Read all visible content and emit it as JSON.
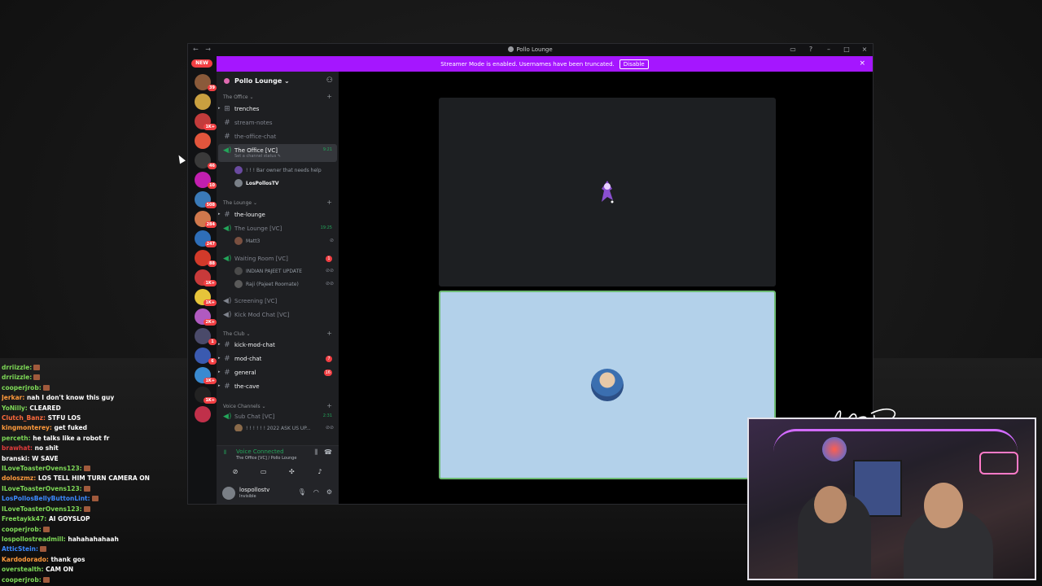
{
  "window": {
    "title": "Pollo Lounge",
    "nav_back": "←",
    "nav_forward": "→"
  },
  "streamer_bar": {
    "message": "Streamer Mode is enabled. Usernames have been truncated.",
    "button": "Disable"
  },
  "rail": {
    "new_badge": "NEW",
    "servers": [
      {
        "badge": "39",
        "color": "#8a5a3a"
      },
      {
        "badge": "",
        "color": "#c9a040"
      },
      {
        "badge": "1K+",
        "color": "#c23b3b"
      },
      {
        "badge": "",
        "color": "#e2553c"
      },
      {
        "badge": "46",
        "color": "#3a3a3a"
      },
      {
        "badge": "10",
        "color": "#c21fb0"
      },
      {
        "badge": "508",
        "color": "#3a7ab8"
      },
      {
        "badge": "284",
        "color": "#d0784c"
      },
      {
        "badge": "247",
        "color": "#2e6eb8"
      },
      {
        "badge": "88",
        "color": "#d23a2a"
      },
      {
        "badge": "1K+",
        "color": "#c83a3a"
      },
      {
        "badge": "1K+",
        "color": "#e6c43a"
      },
      {
        "badge": "2K+",
        "color": "#b05ac0"
      },
      {
        "badge": "1",
        "color": "#4a4a6a"
      },
      {
        "badge": "6",
        "color": "#3a5ab0"
      },
      {
        "badge": "1K+",
        "color": "#3a8ad0"
      },
      {
        "badge": "1K+",
        "color": "#222222"
      },
      {
        "badge": "",
        "color": "#c0304a"
      }
    ]
  },
  "guild": {
    "name": "Pollo Lounge ⌄"
  },
  "categories": {
    "office": "The Office ⌄",
    "lounge": "The Lounge ⌄",
    "club": "The Club ⌄",
    "voice": "Voice Channels ⌄"
  },
  "channels": {
    "trenches": "trenches",
    "stream_notes": "stream-notes",
    "office_chat": "the-office-chat",
    "office_vc": "The Office [VC]",
    "office_vc_time": "9:21",
    "office_vc_status": "Set a channel status ✎",
    "office_user1": "! ! ! Bar owner that needs help",
    "office_user2": "LosPollosTV",
    "the_lounge": "the-lounge",
    "lounge_vc": "The Lounge [VC]",
    "lounge_vc_time": "19:25",
    "lounge_user": "Matt3",
    "waiting_vc": "Waiting Room [VC]",
    "waiting_count": "1",
    "waiting_user1": "INDIAN PAJEET UPDATE",
    "waiting_user2": "Raji (Pajeet Roomate)",
    "screening_vc": "Screening [VC]",
    "kick_mod_vc": "Kick Mod Chat [VC]",
    "kick_mod_chat": "kick-mod-chat",
    "mod_chat": "mod-chat",
    "mod_chat_count": "7",
    "general": "general",
    "general_count": "16",
    "the_cave": "the-cave",
    "sub_chat_vc": "Sub Chat [VC]",
    "sub_chat_time": "2:31",
    "sub_chat_user": "! ! ! ! ! ! 2022 ASK US UP..."
  },
  "voice_panel": {
    "title": "Voice Connected",
    "subtitle": "The Office [VC] / Pollo Lounge"
  },
  "user_panel": {
    "username": "lospollostv",
    "status": "Invisible"
  },
  "chat": [
    {
      "user": "drriizzle:",
      "color": "#7ed957",
      "text": ""
    },
    {
      "user": "drriizzle:",
      "color": "#7ed957",
      "text": ""
    },
    {
      "user": "cooperjrob:",
      "color": "#7ed957",
      "text": ""
    },
    {
      "user": "Jerkar:",
      "color": "#ff9a3c",
      "text": "nah I don't know this guy"
    },
    {
      "user": "YoNilly:",
      "color": "#7ed957",
      "text": "CLEARED"
    },
    {
      "user": "Clutch_Banz:",
      "color": "#ff6a3c",
      "text": "STFU LOS"
    },
    {
      "user": "kingmonterey:",
      "color": "#ff9a3c",
      "text": "get fuked"
    },
    {
      "user": "perceth:",
      "color": "#7ed957",
      "text": "he talks like a robot fr"
    },
    {
      "user": "brawhat:",
      "color": "#e23c3c",
      "text": "no shit"
    },
    {
      "user": "branski:",
      "color": "#ffffff",
      "text": "W SAVE"
    },
    {
      "user": "ILoveToasterOvens123:",
      "color": "#7ed957",
      "text": ""
    },
    {
      "user": "doloszmz:",
      "color": "#ff9a3c",
      "text": "LOS TELL HIM TURN CAMERA ON"
    },
    {
      "user": "ILoveToasterOvens123:",
      "color": "#7ed957",
      "text": ""
    },
    {
      "user": "LosPollosBellyButtonLint:",
      "color": "#3c8aff",
      "text": ""
    },
    {
      "user": "ILoveToasterOvens123:",
      "color": "#7ed957",
      "text": ""
    },
    {
      "user": "Freetaykk47:",
      "color": "#7ed957",
      "text": "AI GOYSLOP"
    },
    {
      "user": "cooperjrob:",
      "color": "#7ed957",
      "text": ""
    },
    {
      "user": "lospollostreadmill:",
      "color": "#7ed957",
      "text": "hahahahahaah"
    },
    {
      "user": "AtticStein:",
      "color": "#3c8aff",
      "text": ""
    },
    {
      "user": "Kardodorado:",
      "color": "#ff9a3c",
      "text": "thank gos"
    },
    {
      "user": "overstealth:",
      "color": "#7ed957",
      "text": "CAM ON"
    },
    {
      "user": "cooperjrob:",
      "color": "#7ed957",
      "text": ""
    }
  ]
}
